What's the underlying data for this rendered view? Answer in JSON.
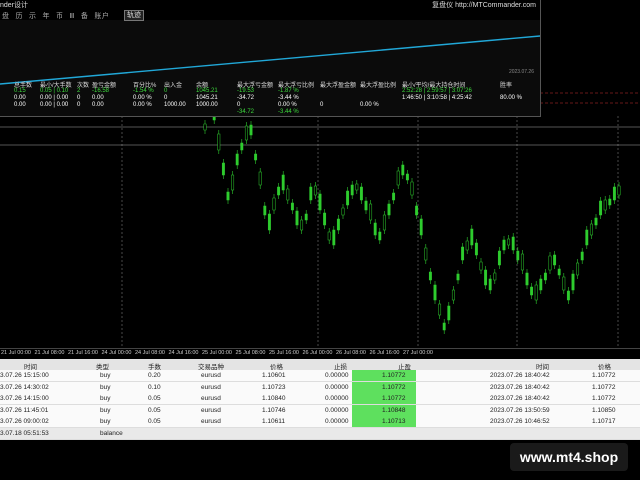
{
  "panel": {
    "title": "nder设计",
    "brand": "复盘仪 http://MTCommander.com",
    "menu": [
      "盘",
      "历",
      "示",
      "年",
      "币",
      "Ⅲ",
      "备",
      "账户"
    ],
    "tab_label": "轨迹",
    "date_stamp": "2023.07.26"
  },
  "stats": {
    "headers": [
      "总手数",
      "最小/大手数",
      "次数",
      "盈亏金额",
      "百分比%",
      "出入金",
      "余额",
      "最大浮亏金额",
      "最大浮亏比例",
      "最大浮盈金额",
      "最大浮盈比例",
      "最小/平均/最大持仓时间",
      "胜率"
    ],
    "rows": [
      {
        "cells": [
          "0.15",
          "0.05 | 0.10",
          "2",
          "-16.58",
          "-1.54 %",
          "0",
          "1045.21",
          "-19.53",
          "-1.87 %",
          "",
          "",
          "2:52:28 | 2:59:57 | 3:07:26",
          ""
        ],
        "color": "#3ddc3d"
      },
      {
        "cells": [
          "0.00",
          "0.00 | 0.00",
          "0",
          "0.00",
          "0.00 %",
          "0",
          "1045.21",
          "-34.72",
          "-3.44 %",
          "",
          "",
          "1:46:50 | 3:10:58 | 4:25:42",
          "80.00 %"
        ],
        "color": "#ffffff"
      },
      {
        "cells": [
          "0.00",
          "0.00 | 0.00",
          "0",
          "0.00",
          "0.00 %",
          "1000.00",
          "1000.00",
          "0",
          "0.00 %",
          "0",
          "0.00 %",
          "",
          ""
        ],
        "color": "#ffffff"
      },
      {
        "cells": [
          "",
          "",
          "",
          "",
          "",
          "",
          "",
          "-34.72",
          "-3.44 %",
          "",
          "",
          "",
          ""
        ],
        "color": "#3ddc3d"
      }
    ]
  },
  "timeaxis": [
    "21 Jul 00:00",
    "21 Jul 08:00",
    "21 Jul 16:00",
    "24 Jul 00:00",
    "24 Jul 08:00",
    "24 Jul 16:00",
    "25 Jul 00:00",
    "25 Jul 08:00",
    "25 Jul 16:00",
    "26 Jul 00:00",
    "26 Jul 08:00",
    "26 Jul 16:00",
    "27 Jul 00:00"
  ],
  "table": {
    "headers": [
      "时间",
      "类型",
      "手数",
      "交易品种",
      "价格",
      "止损",
      "止盈",
      "时间",
      "价格"
    ],
    "rows": [
      {
        "open_time": "3.07.26 15:15:00",
        "type": "buy",
        "lots": "0.20",
        "symbol": "eurusd",
        "price": "1.10601",
        "sl": "0.00000",
        "tp": "1.10772",
        "close_time": "2023.07.26 18:40:42",
        "close_price": "1.10772"
      },
      {
        "open_time": "3.07.26 14:30:02",
        "type": "buy",
        "lots": "0.10",
        "symbol": "eurusd",
        "price": "1.10723",
        "sl": "0.00000",
        "tp": "1.10772",
        "close_time": "2023.07.26 18:40:42",
        "close_price": "1.10772"
      },
      {
        "open_time": "3.07.26 14:15:00",
        "type": "buy",
        "lots": "0.05",
        "symbol": "eurusd",
        "price": "1.10840",
        "sl": "0.00000",
        "tp": "1.10772",
        "close_time": "2023.07.26 18:40:42",
        "close_price": "1.10772"
      },
      {
        "open_time": "3.07.26 11:45:01",
        "type": "buy",
        "lots": "0.05",
        "symbol": "eurusd",
        "price": "1.10746",
        "sl": "0.00000",
        "tp": "1.10848",
        "close_time": "2023.07.26 13:50:59",
        "close_price": "1.10850"
      },
      {
        "open_time": "3.07.26 09:00:02",
        "type": "buy",
        "lots": "0.05",
        "symbol": "eurusd",
        "price": "1.10611",
        "sl": "0.00000",
        "tp": "1.10713",
        "close_time": "2023.07.26 10:46:52",
        "close_price": "1.10717"
      },
      {
        "open_time": "3.07.18 05:51:53",
        "type": "balance",
        "lots": "",
        "symbol": "",
        "price": "",
        "sl": "",
        "tp": "",
        "close_time": "",
        "close_price": ""
      }
    ]
  },
  "watermark": "www.mt4.shop",
  "colors": {
    "candle": "#2ecc2e",
    "equity": "#21a8d8",
    "panel": "#0b0b0b"
  }
}
